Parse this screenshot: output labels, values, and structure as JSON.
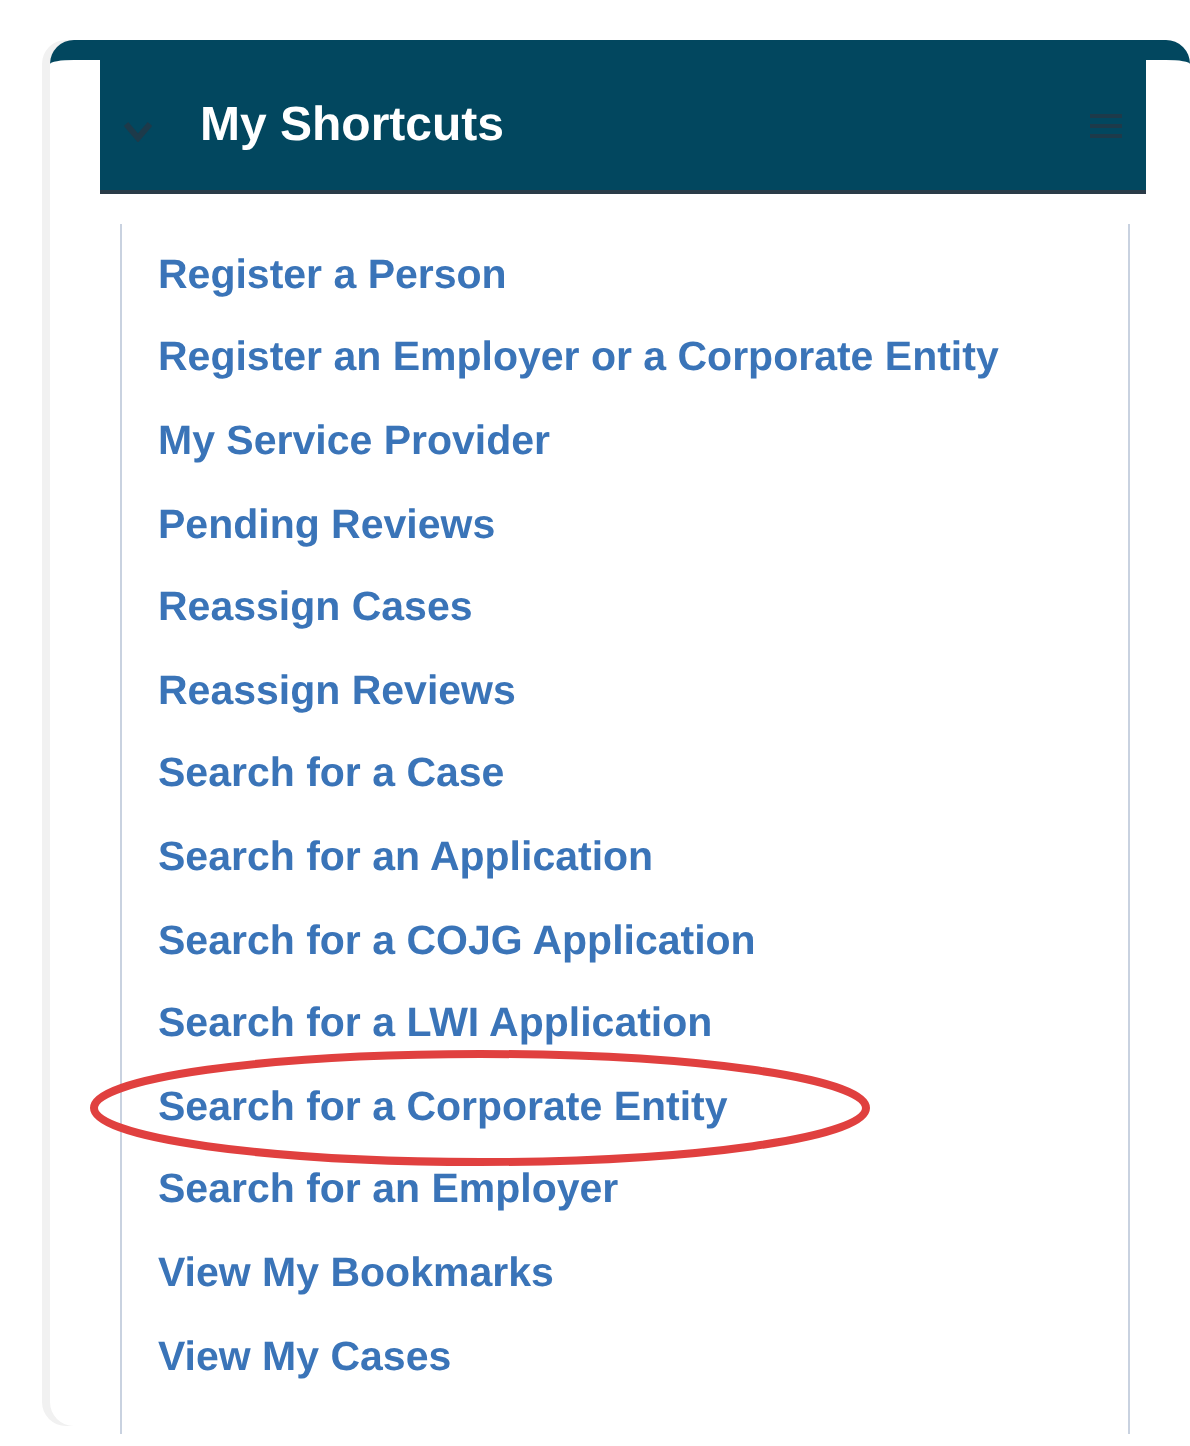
{
  "panel": {
    "title": "My Shortcuts"
  },
  "shortcuts": [
    {
      "label": "Register a Person",
      "highlighted": false
    },
    {
      "label": "Register an Employer or a Corporate Entity",
      "highlighted": false
    },
    {
      "label": "My Service Provider",
      "highlighted": false
    },
    {
      "label": "Pending Reviews",
      "highlighted": false
    },
    {
      "label": "Reassign Cases",
      "highlighted": false
    },
    {
      "label": "Reassign Reviews",
      "highlighted": false
    },
    {
      "label": "Search for a Case",
      "highlighted": false
    },
    {
      "label": "Search for an Application",
      "highlighted": false
    },
    {
      "label": "Search for a COJG Application",
      "highlighted": false
    },
    {
      "label": "Search for a LWI Application",
      "highlighted": false
    },
    {
      "label": "Search for a Corporate Entity",
      "highlighted": true
    },
    {
      "label": "Search for an Employer",
      "highlighted": false
    },
    {
      "label": "View My Bookmarks",
      "highlighted": false
    },
    {
      "label": "View My Cases",
      "highlighted": false
    }
  ]
}
